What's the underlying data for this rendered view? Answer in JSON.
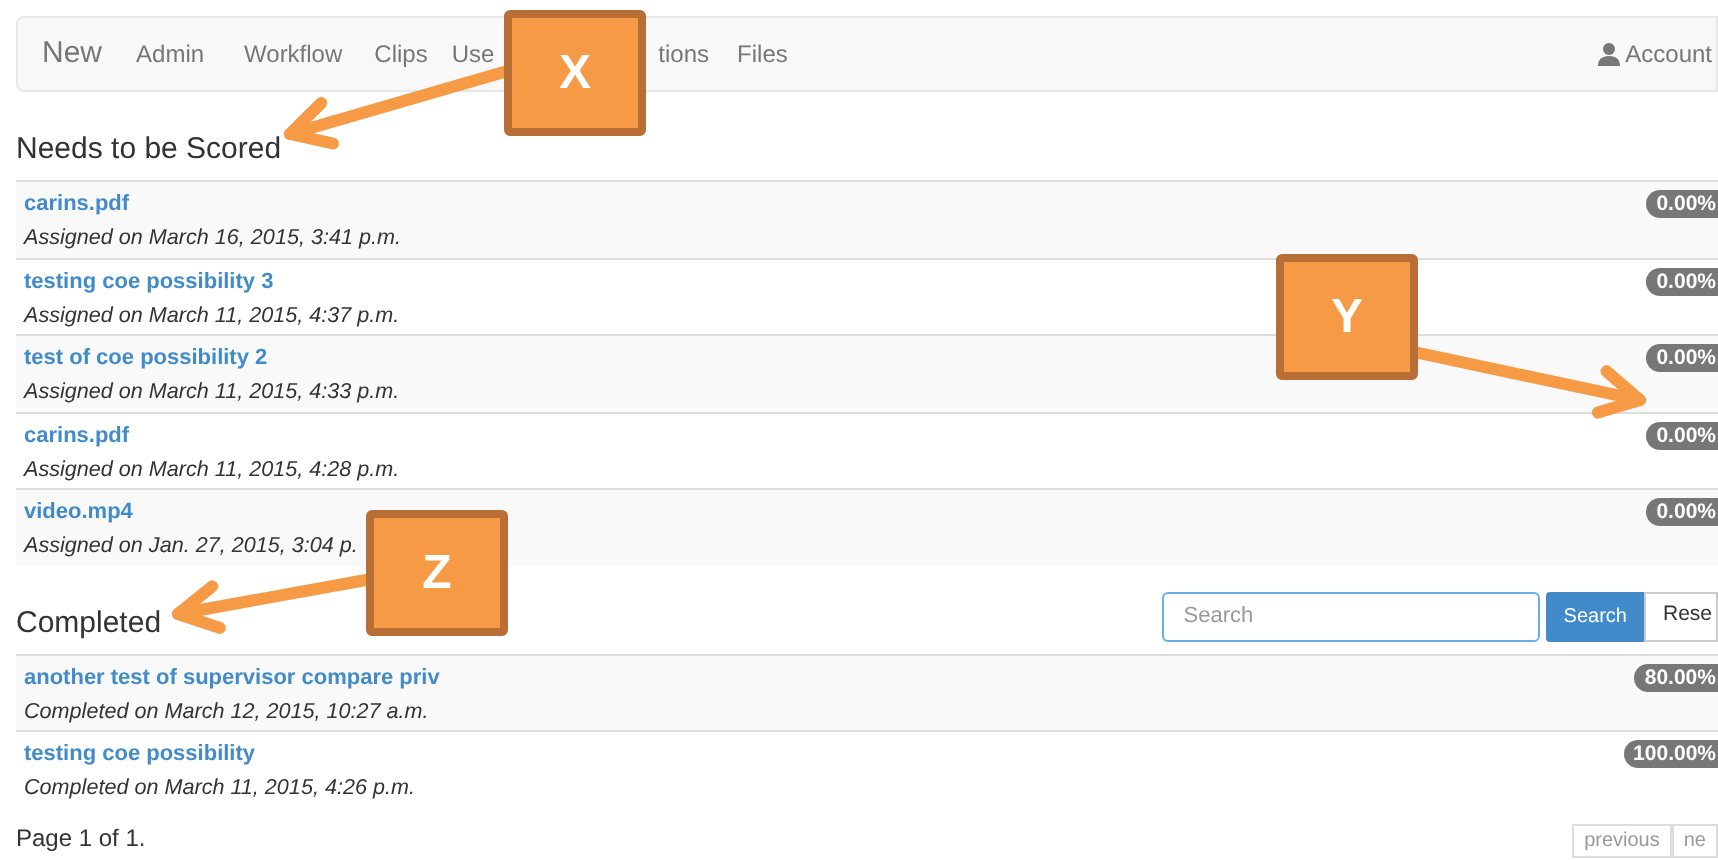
{
  "nav": {
    "brand": "New",
    "items": [
      "Admin",
      "Workflow",
      "Clips",
      "Use",
      "tions",
      "Files"
    ],
    "account": "Account"
  },
  "sections": [
    {
      "title": "Needs to be Scored",
      "rows": [
        {
          "name": "carins.pdf",
          "meta": "Assigned on March 16, 2015, 3:41 p.m.",
          "badge": "0.00%"
        },
        {
          "name": "testing coe possibility 3",
          "meta": "Assigned on March 11, 2015, 4:37 p.m.",
          "badge": "0.00%"
        },
        {
          "name": "test of coe possibility 2",
          "meta": "Assigned on March 11, 2015, 4:33 p.m.",
          "badge": "0.00%"
        },
        {
          "name": "carins.pdf",
          "meta": "Assigned on March 11, 2015, 4:28 p.m.",
          "badge": "0.00%"
        },
        {
          "name": "video.mp4",
          "meta": "Assigned on Jan. 27, 2015, 3:04 p.",
          "badge": "0.00%"
        }
      ]
    },
    {
      "title": "Completed",
      "search": {
        "placeholder": "Search",
        "button": "Search",
        "reset": "Rese"
      },
      "rows": [
        {
          "name": "another test of supervisor compare priv",
          "meta": "Completed on March 12, 2015, 10:27 a.m.",
          "badge": "80.00%"
        },
        {
          "name": "testing coe possibility",
          "meta": "Completed on March 11, 2015, 4:26 p.m.",
          "badge": "100.00%"
        }
      ]
    }
  ],
  "pager": {
    "text": "Page 1 of 1.",
    "buttons": [
      "previous",
      "ne"
    ]
  },
  "callouts": [
    {
      "label": "X"
    },
    {
      "label": "Y"
    },
    {
      "label": "Z"
    }
  ]
}
